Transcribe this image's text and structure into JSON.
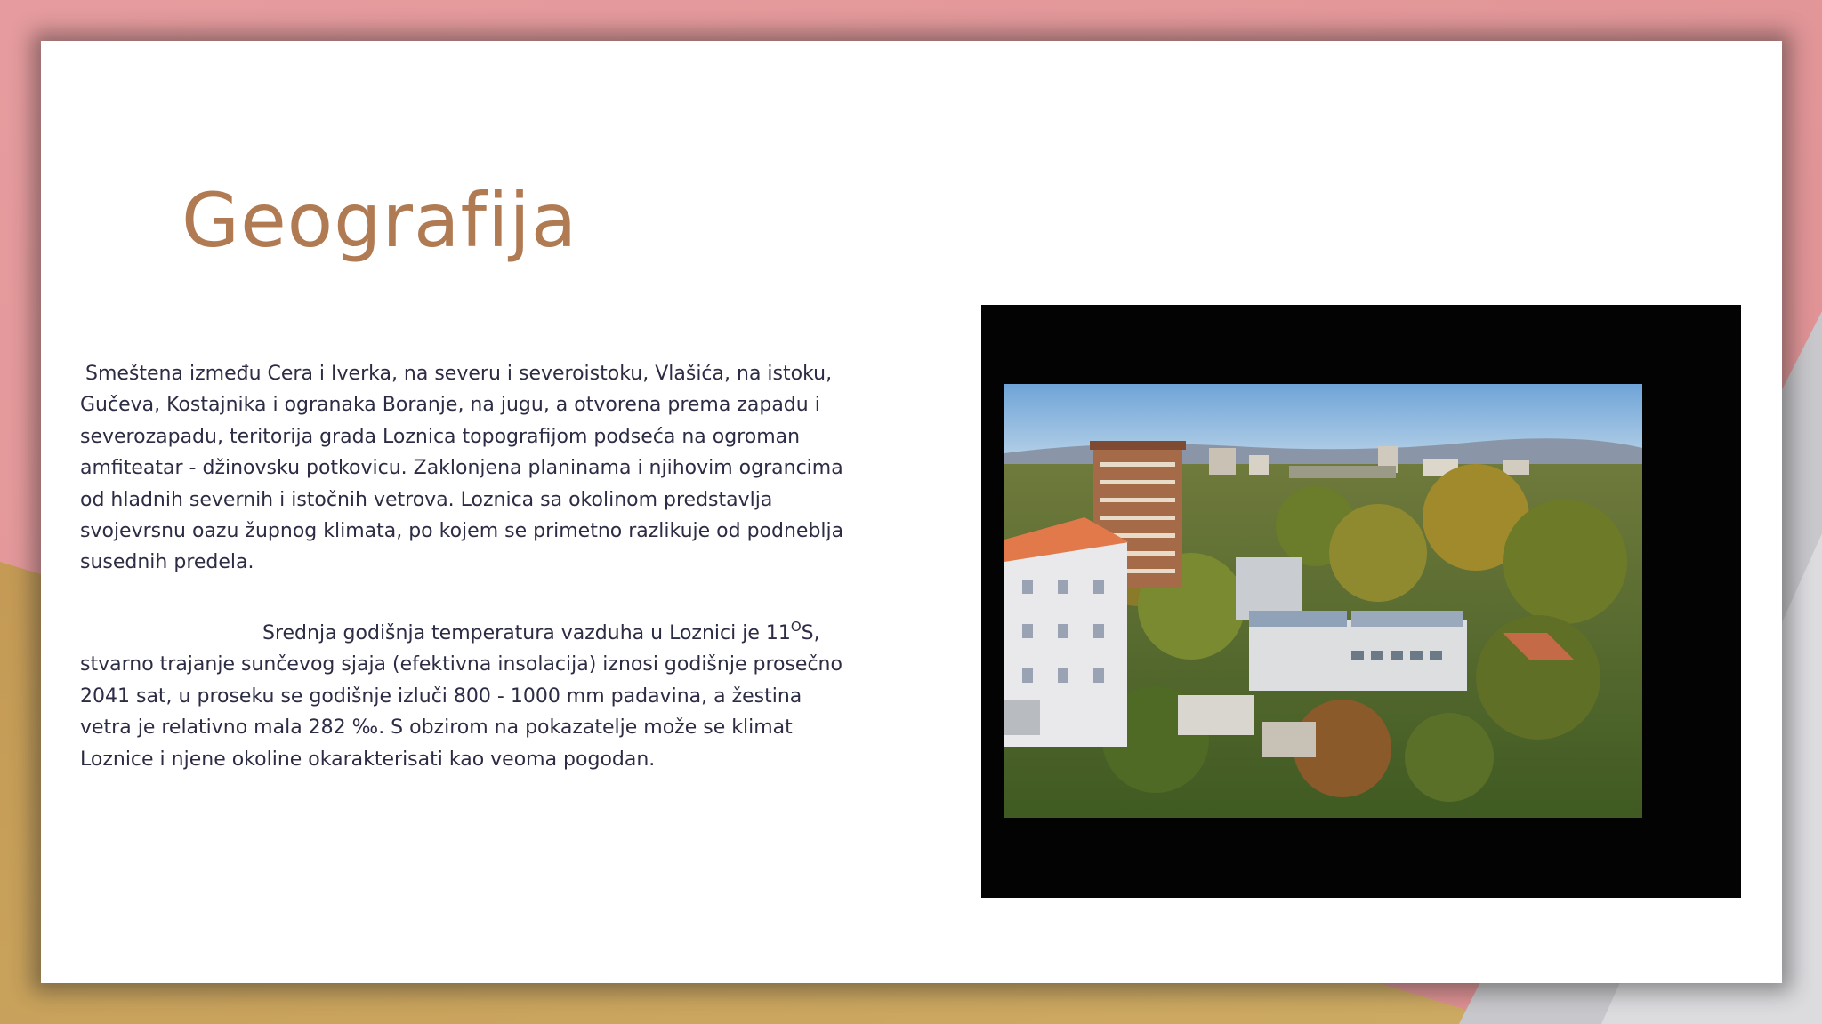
{
  "slide": {
    "title": "Geografija",
    "paragraph_1": "Smeštena između Cera i Iverka, na severu i severoistoku, Vlašića, na istoku, Gučeva, Kostajnika i ogranaka Boranje, na jugu, a otvorena prema zapadu i severozapadu, teritorija grada Loznica topografijom podseća na ogroman amfiteatar - džinovsku potkovicu. Zaklonjena planinama i njihovim ograncima od hladnih severnih i istočnih vetrova. Loznica sa okolinom predstavlja svojevrsnu oazu župnog klimata, po kojem se primetno razlikuje od podneblja susednih predela.",
    "paragraph_2_before_sup": "Srednja godišnja temperatura vazduha u Loznici je 11",
    "paragraph_2_sup": "O",
    "paragraph_2_after_sup": "S, stvarno trajanje sunčevog sjaja (efektivna insolacija) iznosi godišnje prosečno 2041 sat, u proseku se godišnje izluči 800 - 1000 mm padavina, a žestina vetra je relativno mala 282 ‰. S obzirom na pokazatelje može se klimat Loznice i njene okoline okarakterisati kao veoma pogodan."
  },
  "colors": {
    "title": "#b07a52",
    "body_text": "#2c2c44",
    "background_pink": "#e39a9b",
    "background_gold": "#c9a35c",
    "background_gray": "#c9c9cd",
    "photo_frame": "#030303"
  }
}
